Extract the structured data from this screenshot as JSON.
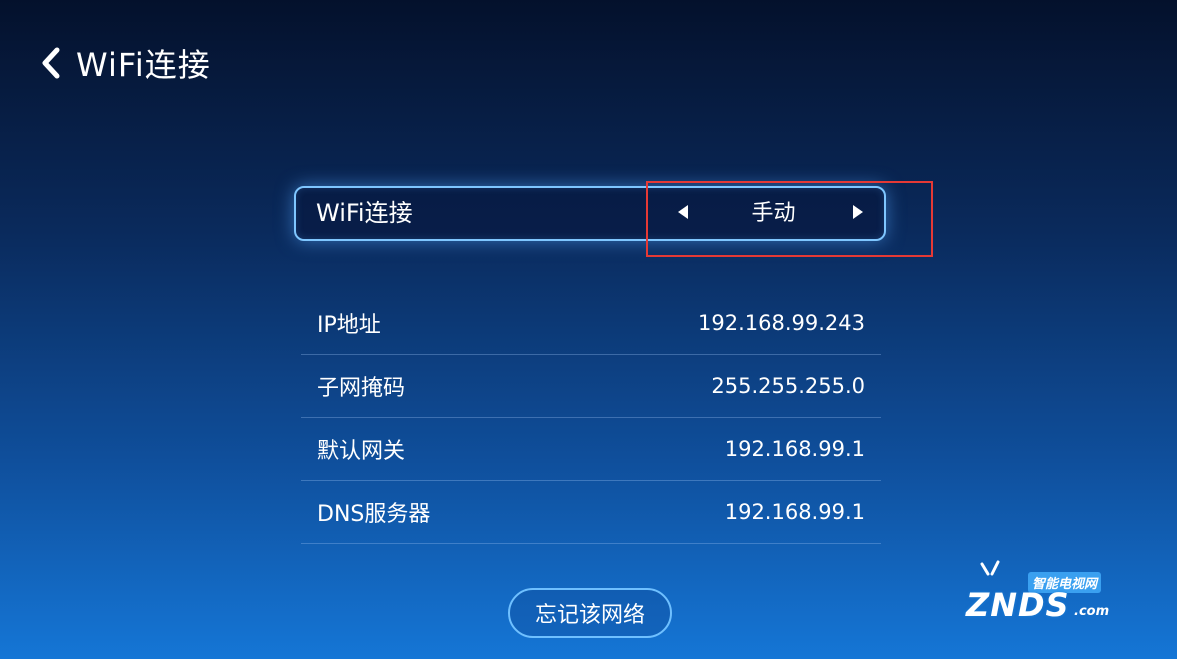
{
  "header": {
    "title": "WiFi连接"
  },
  "connection_mode": {
    "label": "WiFi连接",
    "value": "手动"
  },
  "info_rows": [
    {
      "label": "IP地址",
      "value": "192.168.99.243"
    },
    {
      "label": "子网掩码",
      "value": "255.255.255.0"
    },
    {
      "label": "默认网关",
      "value": "192.168.99.1"
    },
    {
      "label": "DNS服务器",
      "value": "192.168.99.1"
    }
  ],
  "forget_button": {
    "label": "忘记该网络"
  },
  "watermark": {
    "subtitle": "智能电视网",
    "brand": "ZNDS",
    "domain": ".com"
  },
  "colors": {
    "highlight": "#e53935",
    "accent_border": "#7fc6ff"
  },
  "icons": {
    "back": "chevron-left-icon",
    "prev": "triangle-left-icon",
    "next": "triangle-right-icon"
  }
}
